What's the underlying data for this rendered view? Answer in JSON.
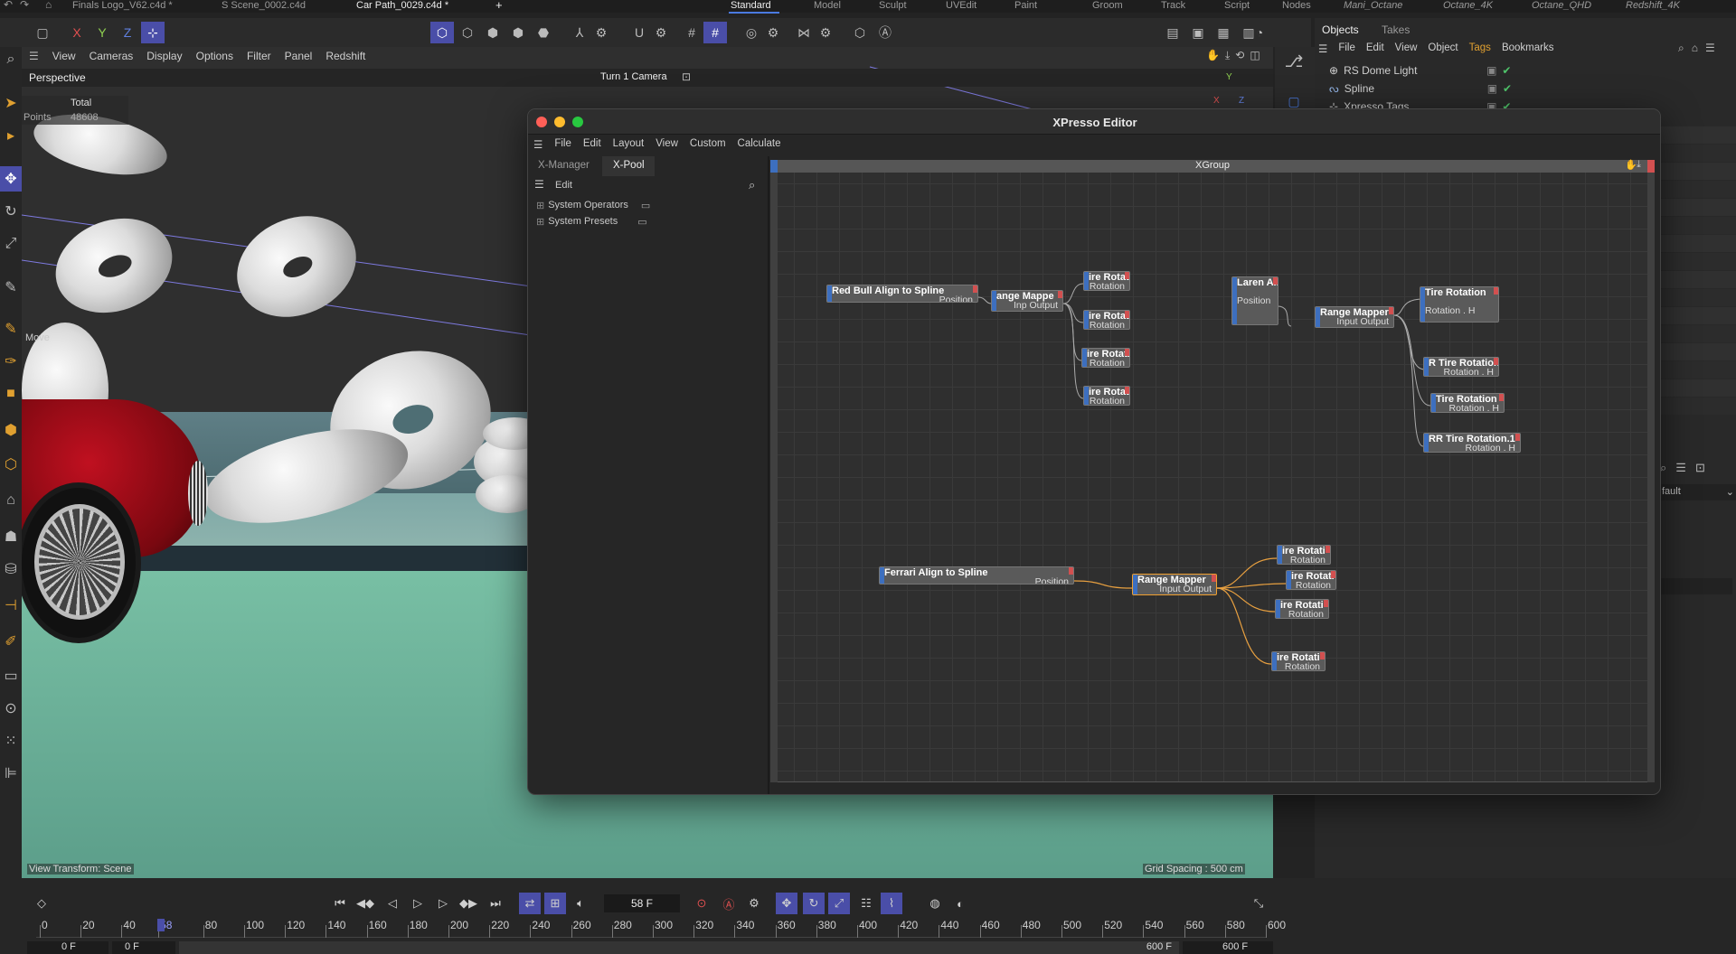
{
  "doc_tabs": [
    {
      "label": "Finals Logo_V62.c4d *"
    },
    {
      "label": "S Scene_0002.c4d"
    },
    {
      "label": "Car Path_0029.c4d *"
    },
    {
      "label": "+"
    }
  ],
  "layouts": [
    "Standard",
    "Model",
    "Sculpt",
    "UVEdit",
    "Paint",
    "Groom",
    "Track",
    "Script",
    "Nodes",
    "Mani_Octane",
    "Octane_4K",
    "Octane_QHD",
    "Redshift_4K"
  ],
  "axes": {
    "x": "X",
    "y": "Y",
    "z": "Z"
  },
  "viewport": {
    "menu": [
      "View",
      "Cameras",
      "Display",
      "Options",
      "Filter",
      "Panel",
      "Redshift"
    ],
    "name": "Perspective",
    "camera": "Turn 1 Camera",
    "hud_total": "Total",
    "hud_points_label": "Points",
    "hud_points_value": "48608",
    "bottom_left": "View Transform: Scene",
    "bottom_right": "Grid Spacing : 500 cm",
    "move_label": "Move"
  },
  "right_panel": {
    "tabs": [
      "Objects",
      "Takes"
    ],
    "menu": [
      "File",
      "Edit",
      "View",
      "Object",
      "Tags",
      "Bookmarks"
    ],
    "objects": [
      {
        "name": "RS Dome Light"
      },
      {
        "name": "Spline"
      },
      {
        "name": "Xpresso Tags"
      }
    ],
    "attr_value": "fault"
  },
  "xpresso": {
    "title": "XPresso Editor",
    "menu": [
      "File",
      "Edit",
      "Layout",
      "View",
      "Custom",
      "Calculate"
    ],
    "tabs": [
      "X-Manager",
      "X-Pool"
    ],
    "pool_menu": "Edit",
    "tree": [
      "System Operators",
      "System Presets"
    ],
    "group_title": "XGroup",
    "nodes": [
      {
        "title": "Red Bull Align to Spline",
        "port": "Position"
      },
      {
        "title": "ange Mappe",
        "port": "Inp Output"
      },
      {
        "title": "ire Rotati",
        "port": "Rotation"
      },
      {
        "title": "ire Rotati",
        "port": "Rotation"
      },
      {
        "title": "ire Rotati",
        "port": "Rotation"
      },
      {
        "title": "ire Rotati",
        "port": "Rotation"
      },
      {
        "title": "Laren Ali",
        "port": "Position"
      },
      {
        "title": "Range Mapper",
        "port": "Input Output"
      },
      {
        "title": "Tire Rotation",
        "port": "Rotation . H"
      },
      {
        "title": "R Tire Rotation",
        "port": "Rotation . H"
      },
      {
        "title": "Tire Rotation",
        "port": "Rotation . H"
      },
      {
        "title": "RR Tire Rotation.1",
        "port": "Rotation . H"
      },
      {
        "title": "Ferrari Align to Spline",
        "port": "Position"
      },
      {
        "title": "Range Mapper",
        "port": "Input Output"
      },
      {
        "title": "ire Rotati",
        "port": "Rotation"
      },
      {
        "title": "ire Rotati",
        "port": "Rotation"
      },
      {
        "title": "ire Rotati",
        "port": "Rotation"
      },
      {
        "title": "ire Rotati",
        "port": "Rotation"
      }
    ]
  },
  "timeline": {
    "current_frame": "58 F",
    "ticks": [
      "0",
      "20",
      "40",
      "58",
      "80",
      "100",
      "120",
      "140",
      "160",
      "180",
      "200",
      "220",
      "240",
      "260",
      "280",
      "300",
      "320",
      "340",
      "360",
      "380",
      "400",
      "420",
      "440",
      "460",
      "480",
      "500",
      "520",
      "540",
      "560",
      "580",
      "600"
    ],
    "start_a": "0 F",
    "start_b": "0 F",
    "end_a": "600 F",
    "end_b": "600 F"
  },
  "colors": {
    "accent": "#4a4ea8",
    "port_in": "#3d6fbf",
    "port_out": "#d25050",
    "wire_selected": "#e8a040",
    "check": "#4fc46a"
  }
}
